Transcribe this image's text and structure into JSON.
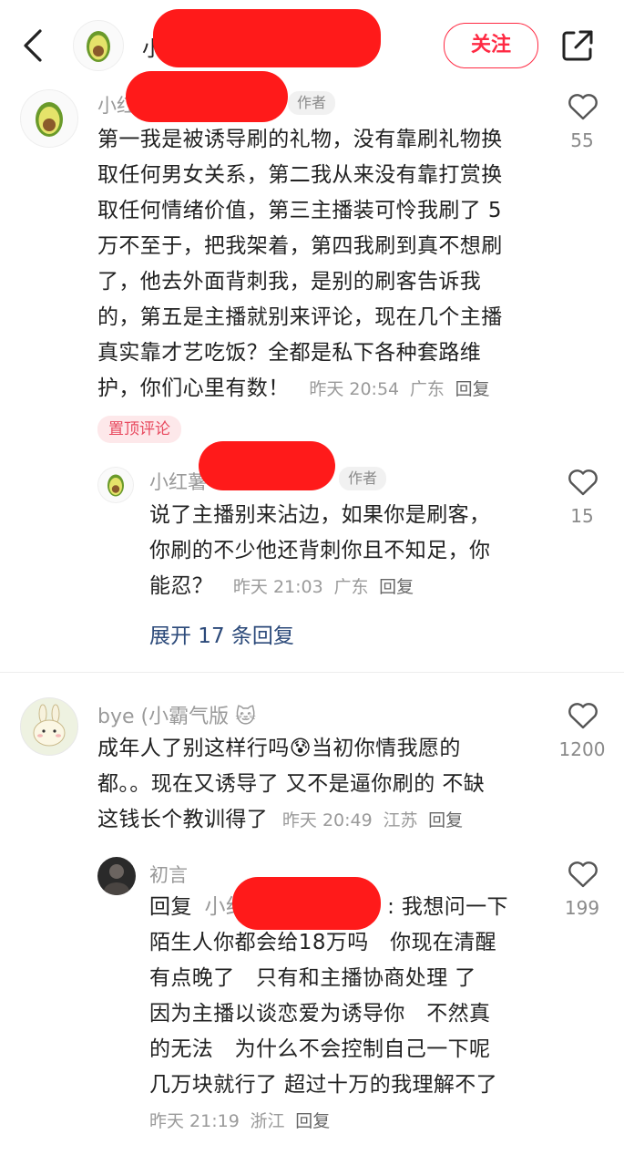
{
  "header": {
    "username_prefix": "小",
    "follow_label": "关注"
  },
  "comments": [
    {
      "username_prefix": "小红",
      "author_badge": "作者",
      "text_lines": [
        "第一我是被诱导刷的礼物，没有靠刷礼物换",
        "取任何男女关系，第二我从来没有靠打赏换",
        "取任何情绪价值，第三主播装可怜我刷了 5",
        "万不至于，把我架着，第四我刷到真不想刷",
        "了，他去外面背刺我，是别的刷客告诉我",
        "的，第五是主播就别来评论，现在几个主播",
        "真实靠才艺吃饭？全都是私下各种套路维"
      ],
      "last_line": "护，你们心里有数！",
      "time": "昨天 20:54",
      "location": "广东",
      "reply_label": "回复",
      "likes": "55",
      "pinned_label": "置顶评论",
      "replies": [
        {
          "username_prefix": "小红薯",
          "author_badge": "作者",
          "text_lines": [
            "说了主播别来沾边，如果你是刷客，",
            "你刷的不少他还背刺你且不知足，你"
          ],
          "last_line": "能忍？",
          "time": "昨天 21:03",
          "location": "广东",
          "reply_label": "回复",
          "likes": "15"
        }
      ],
      "expand_label": "展开 17 条回复"
    },
    {
      "username": "bye (小霸气版 🐱",
      "text_lines": [
        "成年人了别这样行吗😰当初你情我愿的",
        "都。。现在又诱导了 又不是逼你刷的 不缺"
      ],
      "last_line": "这钱长个教训得了",
      "time": "昨天 20:49",
      "location": "江苏",
      "reply_label": "回复",
      "likes": "1200",
      "replies": [
        {
          "username": "初言",
          "reply_prefix": "回复",
          "reply_target_prefix": "小红",
          "reply_first_line_rest": ": 我想问一下",
          "text_lines": [
            "陌生人你都会给18万吗　你现在清醒",
            "有点晚了　只有和主播协商处理 了",
            "因为主播以谈恋爱为诱导你　不然真",
            "的无法　为什么不会控制自己一下呢",
            "几万块就行了 超过十万的我理解不了"
          ],
          "time": "昨天 21:19",
          "location": "浙江",
          "reply_label": "回复",
          "likes": "199"
        }
      ]
    }
  ],
  "colors": {
    "accent": "#ff2a43",
    "redaction": "#ff1a1a",
    "pinned_bg": "#fde8ea",
    "meta_gray": "#9a9a9a"
  }
}
